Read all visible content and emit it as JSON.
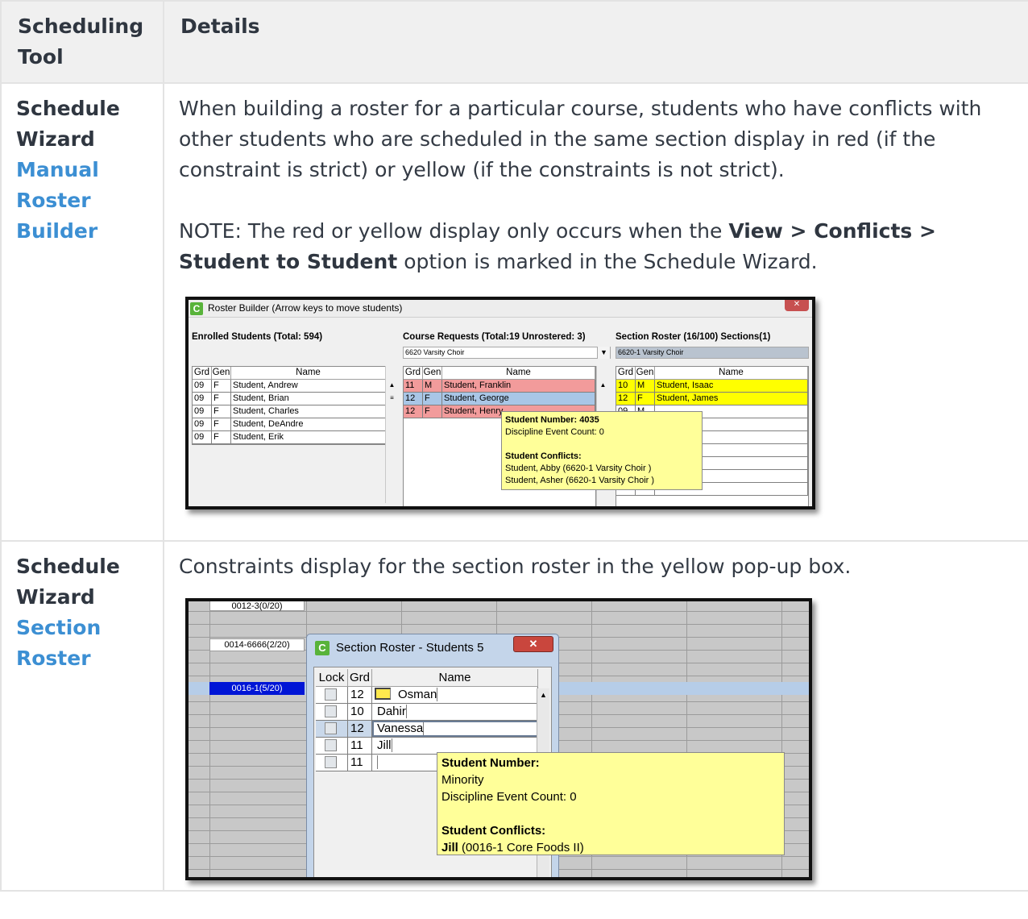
{
  "table": {
    "header": {
      "col1": "Scheduling Tool",
      "col2": "Details"
    },
    "rows": [
      {
        "tool_name": "Schedule Wizard",
        "tool_link": "Manual Roster Builder",
        "details_p1": "When building a roster for a particular course, students who have conflicts with other students who are scheduled in the same section display in red (if the constraint is strict) or yellow (if the constraints is not strict).",
        "note_prefix": "NOTE: The red or yellow display only occurs when the ",
        "note_bold": "View > Conflicts > Student to Student",
        "note_suffix": " option is marked in the Schedule Wizard."
      },
      {
        "tool_name": "Schedule Wizard",
        "tool_link": "Section Roster",
        "details_p1": "Constraints display for the section roster in the yellow pop-up box."
      }
    ]
  },
  "roster_builder": {
    "window_title": "Roster Builder (Arrow keys to move students)",
    "logo": "C",
    "enrolled_title": "Enrolled Students (Total: 594)",
    "requests_title": "Course Requests (Total:19 Unrostered: 3)",
    "section_title": "Section Roster (16/100) Sections(1)",
    "requests_combo": "6620 Varsity Choir",
    "section_combo": "6620-1 Varsity Choir",
    "columns": {
      "grd": "Grd",
      "gen": "Gen",
      "name": "Name"
    },
    "enrolled": [
      {
        "grd": "09",
        "gen": "F",
        "name": "Student, Andrew"
      },
      {
        "grd": "09",
        "gen": "F",
        "name": "Student, Brian"
      },
      {
        "grd": "09",
        "gen": "F",
        "name": "Student, Charles"
      },
      {
        "grd": "09",
        "gen": "F",
        "name": "Student, DeAndre"
      },
      {
        "grd": "09",
        "gen": "F",
        "name": "Student, Erik"
      }
    ],
    "requests": [
      {
        "grd": "11",
        "gen": "M",
        "name": "Student, Franklin"
      },
      {
        "grd": "12",
        "gen": "F",
        "name": "Student, George"
      },
      {
        "grd": "12",
        "gen": "F",
        "name": "Student, Henry"
      }
    ],
    "section": [
      {
        "grd": "10",
        "gen": "M",
        "name": "Student, Isaac"
      },
      {
        "grd": "12",
        "gen": "F",
        "name": "Student, James"
      },
      {
        "grd": "09",
        "gen": "M",
        "name": ""
      }
    ],
    "tooltip": {
      "student_number": "Student Number: 4035",
      "discipline": "Discipline Event Count: 0",
      "conflicts_title": "Student Conflicts:",
      "conflict1": "Student, Abby (6620-1 Varsity Choir )",
      "conflict2": "Student, Asher (6620-1 Varsity Choir )"
    }
  },
  "section_roster": {
    "bg_cells": [
      "0012-3(0/20)",
      "0014-6666(2/20)",
      "0016-1(5/20)"
    ],
    "window_title": "Section Roster - Students 5",
    "logo": "C",
    "columns": {
      "lock": "Lock",
      "grd": "Grd",
      "name": "Name"
    },
    "students": [
      {
        "grd": "12",
        "name": "Osman"
      },
      {
        "grd": "10",
        "name": "Dahir"
      },
      {
        "grd": "12",
        "name": "Vanessa"
      },
      {
        "grd": "11",
        "name": "Jill"
      },
      {
        "grd": "11",
        "name": ""
      }
    ],
    "tooltip": {
      "student_number": "Student Number:",
      "minority": "Minority",
      "discipline": "Discipline Event Count: 0",
      "conflicts_title": "Student Conflicts:",
      "conflict_name": "Jill",
      "conflict_detail": " (0016-1 Core Foods II)"
    }
  },
  "colors": {
    "link": "#3c8fd3",
    "conflict_red": "#f29b9b",
    "conflict_yellow": "#ffff00",
    "tooltip_yellow": "#ffff99",
    "selected_blue": "#0015d6"
  }
}
